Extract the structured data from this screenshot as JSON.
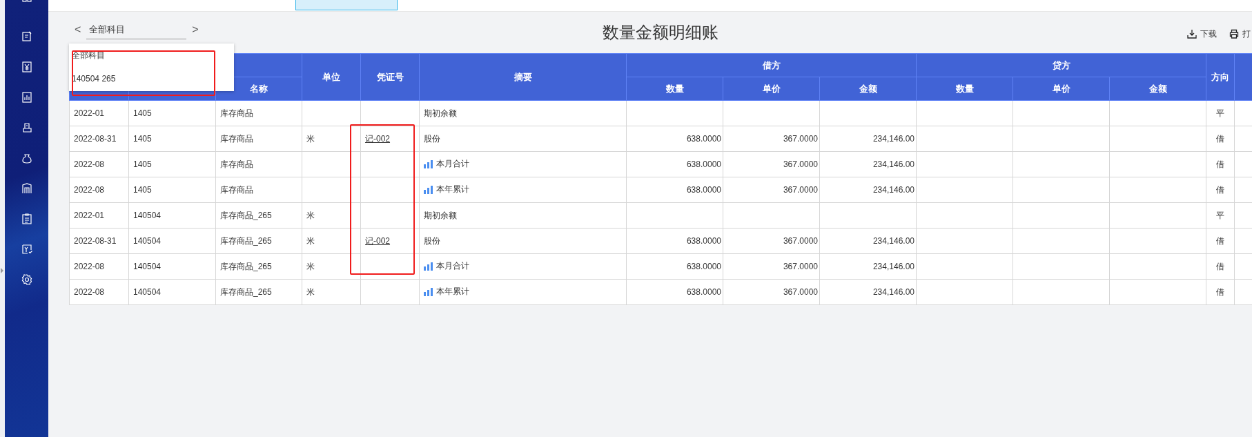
{
  "subject_selector": {
    "value": "全部科目",
    "prev": "<",
    "next": ">"
  },
  "dropdown": {
    "options": [
      {
        "label": "全部科目"
      },
      {
        "label": "140504 265"
      }
    ]
  },
  "title": "数量金额明细账",
  "toolbar": {
    "buttons": [
      {
        "label": "下载",
        "kind": "download"
      },
      {
        "label": "打",
        "kind": "print"
      }
    ]
  },
  "table": {
    "columns": [
      {
        "kind": "blank"
      },
      {
        "kind": "group",
        "children": [
          {
            "kind": "blank"
          },
          {
            "label": "名称"
          }
        ]
      },
      {
        "kind": "single",
        "label": "单位"
      },
      {
        "kind": "single",
        "label": "凭证号"
      },
      {
        "kind": "single",
        "label": "摘要"
      },
      {
        "kind": "group",
        "label": "借方",
        "children": [
          {
            "label": "数量"
          },
          {
            "label": "单价"
          },
          {
            "label": "金额"
          }
        ]
      },
      {
        "kind": "group",
        "label": "贷方",
        "children": [
          {
            "label": "数量"
          },
          {
            "label": "单价"
          },
          {
            "label": "金额"
          }
        ]
      },
      {
        "kind": "single",
        "label": "方向"
      },
      {
        "kind": "blank"
      }
    ],
    "rows": [
      {
        "kind": "opening",
        "date": "2022-01",
        "code": "1405",
        "name": "库存商品",
        "summary": "期初余额",
        "direction": "平"
      },
      {
        "kind": "entry",
        "date": "2022-08-31",
        "code": "1405",
        "name": "库存商品",
        "unit": "米",
        "voucher": "记-002",
        "summary": "股份",
        "debit_qty": "638.0000",
        "debit_price": "367.0000",
        "debit_amount": "234,146.00",
        "direction": "借"
      },
      {
        "kind": "total",
        "date": "2022-08",
        "code": "1405",
        "name": "库存商品",
        "summary": "本月合计",
        "debit_qty": "638.0000",
        "debit_price": "367.0000",
        "debit_amount": "234,146.00",
        "direction": "借"
      },
      {
        "kind": "total",
        "date": "2022-08",
        "code": "1405",
        "name": "库存商品",
        "summary": "本年累计",
        "debit_qty": "638.0000",
        "debit_price": "367.0000",
        "debit_amount": "234,146.00",
        "direction": "借"
      },
      {
        "kind": "opening",
        "date": "2022-01",
        "code": "140504",
        "name": "库存商品_265",
        "unit": "米",
        "summary": "期初余额",
        "direction": "平"
      },
      {
        "kind": "entry",
        "date": "2022-08-31",
        "code": "140504",
        "name": "库存商品_265",
        "unit": "米",
        "voucher": "记-002",
        "summary": "股份",
        "debit_qty": "638.0000",
        "debit_price": "367.0000",
        "debit_amount": "234,146.00",
        "direction": "借"
      },
      {
        "kind": "total",
        "date": "2022-08",
        "code": "140504",
        "name": "库存商品_265",
        "unit": "米",
        "summary": "本月合计",
        "debit_qty": "638.0000",
        "debit_price": "367.0000",
        "debit_amount": "234,146.00",
        "direction": "借"
      },
      {
        "kind": "total",
        "date": "2022-08",
        "code": "140504",
        "name": "库存商品_265",
        "unit": "米",
        "summary": "本年累计",
        "debit_qty": "638.0000",
        "debit_price": "367.0000",
        "debit_amount": "234,146.00",
        "direction": "借"
      }
    ]
  }
}
